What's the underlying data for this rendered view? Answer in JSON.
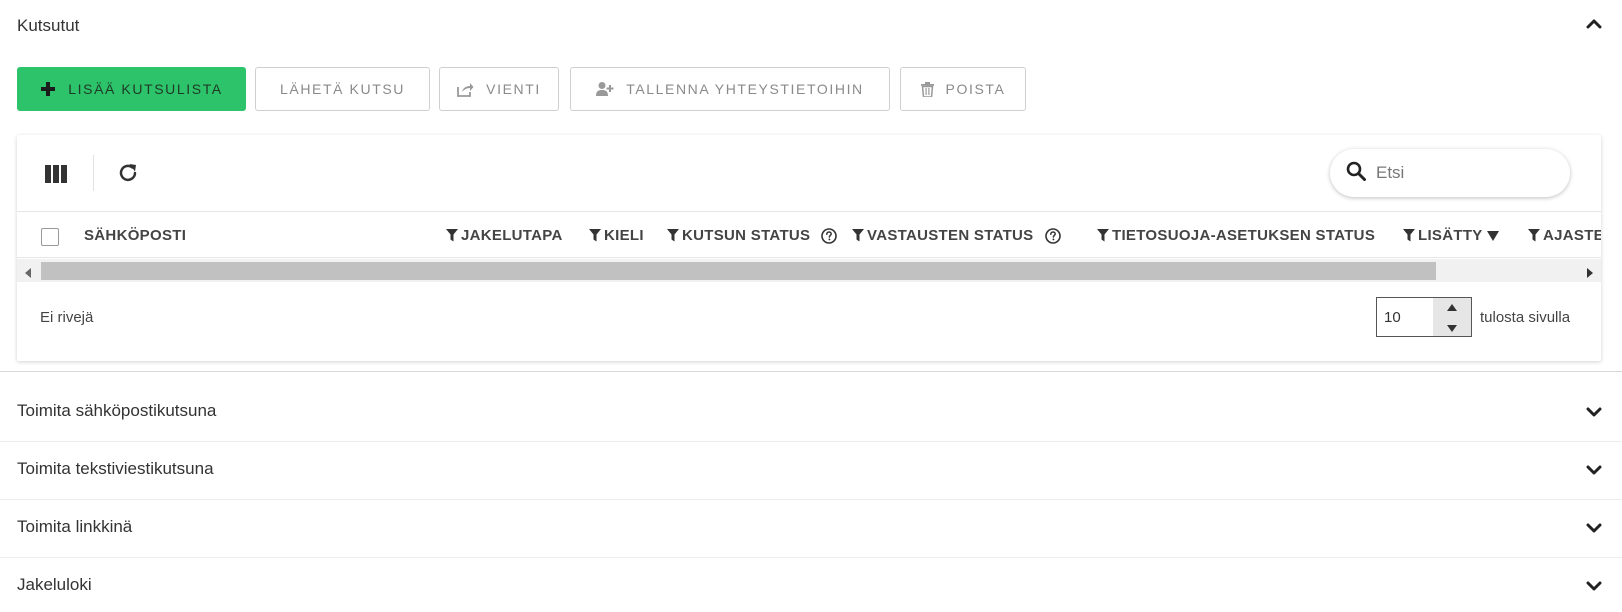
{
  "section": {
    "title": "Kutsutut",
    "expanded": true
  },
  "toolbar": {
    "add_list_label": "LISÄÄ KUTSULISTA",
    "send_invite_label": "LÄHETÄ KUTSU",
    "export_label": "VIENTI",
    "save_contacts_label": "TALLENNA YHTEYSTIETOIHIN",
    "delete_label": "POISTA"
  },
  "search": {
    "placeholder": "Etsi"
  },
  "table": {
    "columns": [
      {
        "label": "SÄHKÖPOSTI",
        "filter": false
      },
      {
        "label": "JAKELUTAPA",
        "filter": true
      },
      {
        "label": "KIELI",
        "filter": true
      },
      {
        "label": "KUTSUN STATUS",
        "filter": true,
        "help": true
      },
      {
        "label": "VASTAUSTEN STATUS",
        "filter": true,
        "help": true
      },
      {
        "label": "TIETOSUOJA-ASETUKSEN STATUS",
        "filter": true
      },
      {
        "label": "LISÄTTY",
        "filter": true,
        "sorted": "desc"
      },
      {
        "label": "AJASTETTU",
        "filter": true
      }
    ],
    "empty_text": "Ei rivejä",
    "page_size": "10",
    "per_page_label": "tulosta sivulla"
  },
  "accordions": [
    {
      "title": "Toimita sähköpostikutsuna"
    },
    {
      "title": "Toimita tekstiviestikutsuna"
    },
    {
      "title": "Toimita linkkinä"
    },
    {
      "title": "Jakeluloki"
    }
  ],
  "colors": {
    "primary": "#2dc36a",
    "text": "#333333",
    "muted": "#8a8a8a"
  }
}
